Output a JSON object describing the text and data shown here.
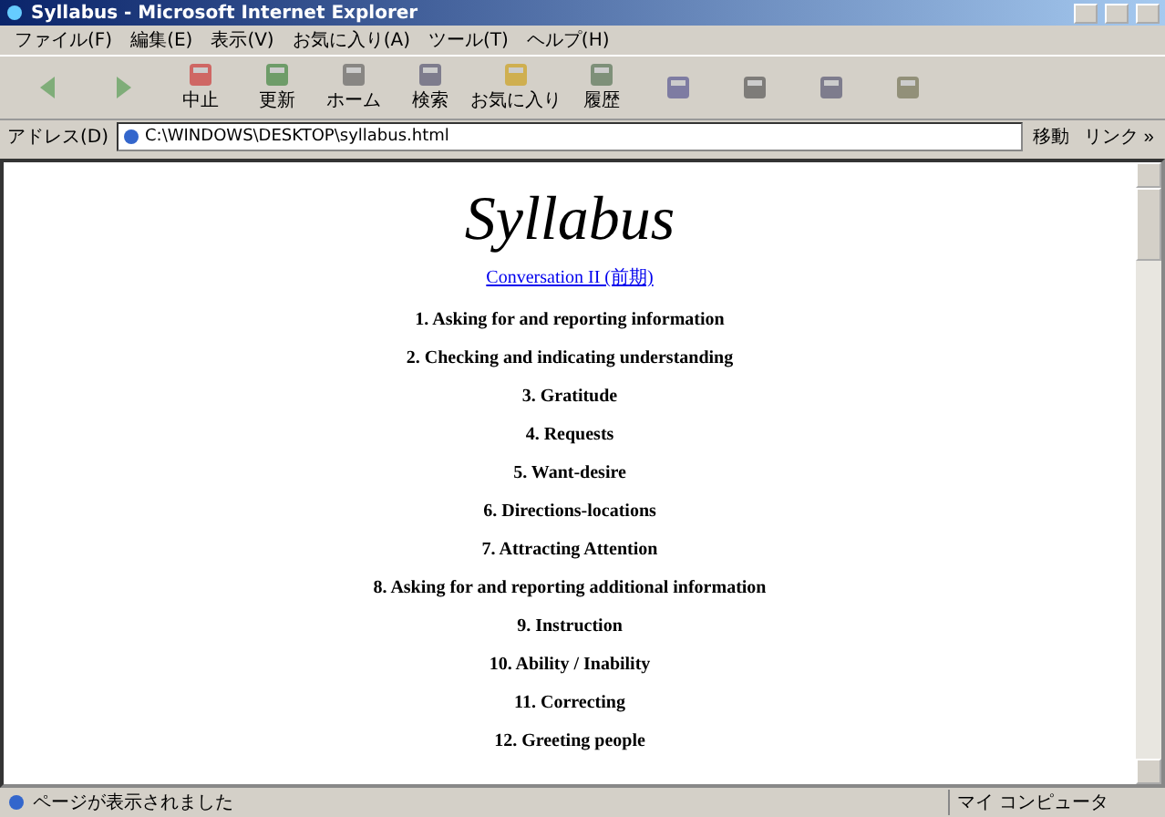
{
  "window": {
    "title": "Syllabus - Microsoft Internet Explorer"
  },
  "menu": [
    "ファイル(F)",
    "編集(E)",
    "表示(V)",
    "お気に入り(A)",
    "ツール(T)",
    "ヘルプ(H)"
  ],
  "toolbar": [
    {
      "kind": "back"
    },
    {
      "kind": "forward"
    },
    {
      "kind": "stop",
      "label": "中止"
    },
    {
      "kind": "refresh",
      "label": "更新"
    },
    {
      "kind": "home",
      "label": "ホーム"
    },
    {
      "kind": "search",
      "label": "検索"
    },
    {
      "kind": "favorites",
      "label": "お気に入り"
    },
    {
      "kind": "history",
      "label": "履歴"
    },
    {
      "kind": "mail"
    },
    {
      "kind": "print"
    },
    {
      "kind": "edit"
    },
    {
      "kind": "discuss"
    }
  ],
  "address": {
    "label": "アドレス(D)",
    "value": "C:\\WINDOWS\\DESKTOP\\syllabus.html",
    "go": "移動",
    "links": "リンク »"
  },
  "page": {
    "title": "Syllabus",
    "link": "Conversation II (前期)",
    "items": [
      "1. Asking for and reporting information",
      "2. Checking and indicating understanding",
      "3. Gratitude",
      "4. Requests",
      "5. Want-desire",
      "6. Directions-locations",
      "7. Attracting Attention",
      "8. Asking for and reporting additional information",
      "9. Instruction",
      "10. Ability / Inability",
      "11. Correcting",
      "12. Greeting people"
    ]
  },
  "status_bar": {
    "text": "ページが表示されました",
    "zone": "マイ コンピュータ"
  }
}
